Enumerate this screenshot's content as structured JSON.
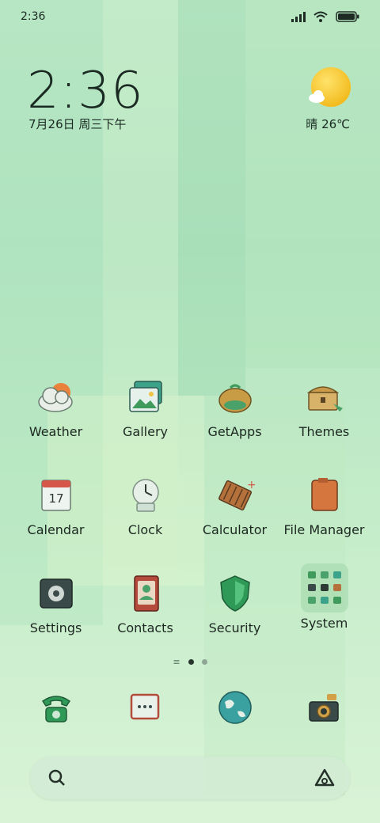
{
  "status_bar": {
    "time": "2:36"
  },
  "clock_widget": {
    "time": "2:36",
    "date": "7月26日 周三下午"
  },
  "weather_widget": {
    "text": "晴 26℃"
  },
  "apps": [
    {
      "label": "Weather",
      "icon": "weather-icon"
    },
    {
      "label": "Gallery",
      "icon": "gallery-icon"
    },
    {
      "label": "GetApps",
      "icon": "getapps-icon"
    },
    {
      "label": "Themes",
      "icon": "themes-icon"
    },
    {
      "label": "Calendar",
      "icon": "calendar-icon",
      "badge": "17"
    },
    {
      "label": "Clock",
      "icon": "clock-icon"
    },
    {
      "label": "Calculator",
      "icon": "calculator-icon"
    },
    {
      "label": "File Manager",
      "icon": "file-manager-icon"
    },
    {
      "label": "Settings",
      "icon": "settings-icon"
    },
    {
      "label": "Contacts",
      "icon": "contacts-icon"
    },
    {
      "label": "Security",
      "icon": "security-icon"
    },
    {
      "label": "System",
      "icon": "system-folder-icon"
    }
  ],
  "page_indicator": {
    "pages": 2,
    "current": 1
  },
  "dock": [
    {
      "icon": "phone-icon"
    },
    {
      "icon": "messages-icon"
    },
    {
      "icon": "browser-icon"
    },
    {
      "icon": "camera-icon"
    }
  ],
  "search_bar": {
    "left_icon": "search-icon",
    "right_icon": "assistant-icon"
  },
  "colors": {
    "background": "#bfe8c9",
    "text": "#1c2721",
    "accent_green": "#3f9a5c"
  }
}
